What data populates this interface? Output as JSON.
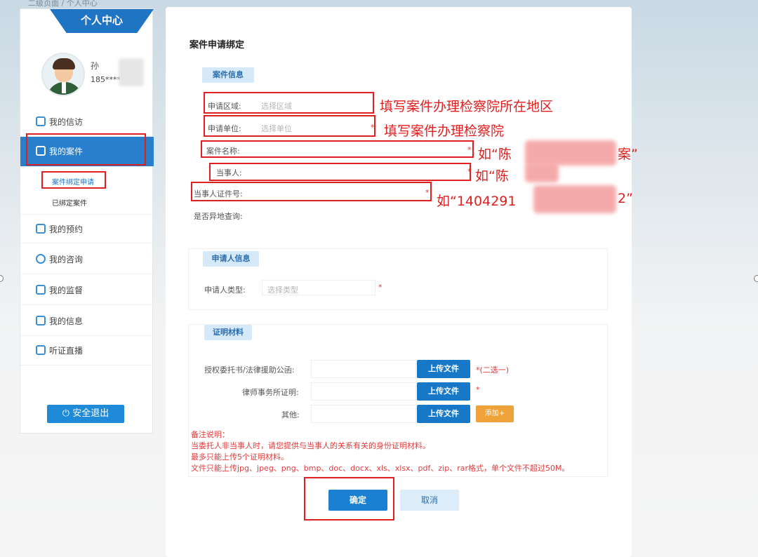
{
  "breadcrumb": "二级页面 / 个人中心",
  "sidebar": {
    "header": "个人中心",
    "user": {
      "name": "孙",
      "phone": "185****"
    },
    "items": [
      {
        "label": "我的信访",
        "icon": "letter-icon"
      },
      {
        "label": "我的案件",
        "icon": "case-icon",
        "active": true
      },
      {
        "label": "我的预约",
        "icon": "calendar-icon"
      },
      {
        "label": "我的咨询",
        "icon": "chat-icon"
      },
      {
        "label": "我的监督",
        "icon": "supervise-icon"
      },
      {
        "label": "我的信息",
        "icon": "id-card-icon"
      },
      {
        "label": "听证直播",
        "icon": "play-icon"
      }
    ],
    "sub_items": [
      {
        "label": "案件绑定申请",
        "current": true
      },
      {
        "label": "已绑定案件"
      }
    ],
    "logout": "安全退出"
  },
  "main": {
    "title": "案件申请绑定",
    "case_info": {
      "tag": "案件信息",
      "area_label": "申请区域:",
      "area_placeholder": "选择区域",
      "unit_label": "申请单位:",
      "unit_placeholder": "选择单位",
      "case_name_label": "案件名称:",
      "party_label": "当事人:",
      "id_label": "当事人证件号:",
      "remote_label": "是否异地查询:",
      "required_mark": "*"
    },
    "applicant": {
      "tag": "申请人信息",
      "type_label": "申请人类型:",
      "type_placeholder": "选择类型",
      "required_mark": "*"
    },
    "materials": {
      "tag": "证明材料",
      "rows": [
        {
          "label": "授权委托书/法律援助公函:",
          "button": "上传文件",
          "note": "*(二选一)"
        },
        {
          "label": "律师事务所证明:",
          "button": "上传文件",
          "note": "*"
        },
        {
          "label": "其他:",
          "button": "上传文件",
          "extra": "添加+"
        }
      ]
    },
    "remarks": [
      "备注说明：",
      "当委托人非当事人时，请您提供与当事人的关系有关的身份证明材料。",
      "最多只能上传5个证明材料。",
      "文件只能上传jpg、jpeg、png、bmp、doc、docx、xls、xlsx、pdf、zip、rar格式，单个文件不超过50M。"
    ],
    "confirm": "确定",
    "cancel": "取消"
  },
  "annotations": {
    "area": "填写案件办理检察院所在地区",
    "unit": "填写案件办理检察院",
    "case_name_prefix": "如“陈",
    "case_name_suffix": "案”",
    "party_prefix": "如“陈",
    "id_prefix": "如“1404291",
    "id_suffix": "2”"
  },
  "colors": {
    "primary": "#1f74c4",
    "annotation_red": "#e02020",
    "add_orange": "#f0a23a"
  }
}
